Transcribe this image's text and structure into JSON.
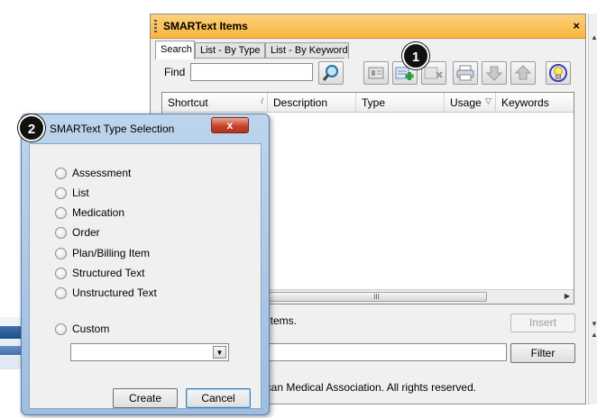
{
  "main_window": {
    "title": "SMARText Items",
    "close_glyph": "×",
    "tabs": [
      {
        "label": "Search",
        "active": true
      },
      {
        "label": "List - By Type",
        "active": false
      },
      {
        "label": "List - By Keyword",
        "active": false
      }
    ],
    "find_label": "Find",
    "find_value": "",
    "toolbar_icons": [
      "details-icon",
      "new-item-icon",
      "delete-item-icon",
      "print-icon",
      "move-down-icon",
      "move-up-icon",
      "idea-icon"
    ],
    "columns": [
      {
        "label": "Shortcut",
        "sort": "/"
      },
      {
        "label": "Description",
        "sort": ""
      },
      {
        "label": "Type",
        "sort": ""
      },
      {
        "label": "Usage",
        "sort": "▽"
      },
      {
        "label": "Keywords",
        "sort": ""
      }
    ],
    "scroll_thumb_glyph": "III",
    "scroll_right_glyph": "▶",
    "status_text": "y Items.",
    "insert_label": "Insert",
    "filter_value": "",
    "filter_label": "Filter",
    "copyright": "ican Medical Association.  All rights reserved."
  },
  "dialog": {
    "title": "SMARText Type Selection",
    "close_glyph": "x",
    "options": [
      "Assessment",
      "List",
      "Medication",
      "Order",
      "Plan/Billing Item",
      "Structured Text",
      "Unstructured Text"
    ],
    "custom_label": "Custom",
    "custom_value": "",
    "dropdown_glyph": "▼",
    "create_label": "Create",
    "cancel_label": "Cancel"
  },
  "callouts": [
    "1",
    "2"
  ],
  "colors": {
    "title_bar": "#f7b43c",
    "dialog_frame": "#9fbde0",
    "close_red": "#c7432a"
  }
}
